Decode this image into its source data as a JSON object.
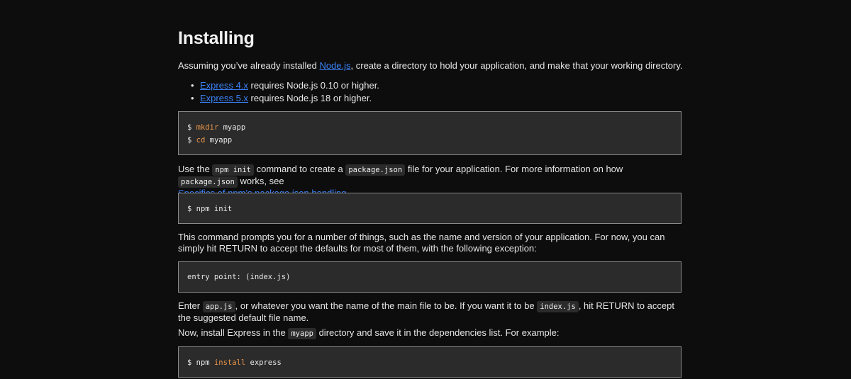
{
  "heading": "Installing",
  "intro": {
    "before": "Assuming you’ve already installed ",
    "link": "Node.js",
    "after": ", create a directory to hold your application, and make that your working directory."
  },
  "versions": [
    {
      "link": "Express 4.x",
      "text": " requires Node.js 0.10 or higher."
    },
    {
      "link": "Express 5.x",
      "text": " requires Node.js 18 or higher."
    }
  ],
  "code1": {
    "line1": {
      "prompt": "$ ",
      "cmd": "mkdir",
      "arg": " myapp"
    },
    "line2": {
      "prompt": "$ ",
      "cmd": "cd",
      "arg": " myapp"
    }
  },
  "p_init": {
    "t1": "Use the ",
    "c1": "npm init",
    "t2": " command to create a ",
    "c2": "package.json",
    "t3": " file for your application. For more information on how ",
    "c3": "package.json",
    "t4": " works, see",
    "link": "Specifics of npm’s package.json handling",
    "t5": "."
  },
  "code2": {
    "text": "$ npm init"
  },
  "p_prompts": "This command prompts you for a number of things, such as the name and version of your application. For now, you can simply hit RETURN to accept the defaults for most of them, with the following exception:",
  "code3": {
    "text": "entry point: (index.js)"
  },
  "p_enter": {
    "t1": "Enter ",
    "c1": "app.js",
    "t2": ", or whatever you want the name of the main file to be. If you want it to be ",
    "c2": "index.js",
    "t3": ", hit RETURN to accept the suggested default file name."
  },
  "p_install": {
    "t1": "Now, install Express in the ",
    "c1": "myapp",
    "t2": " directory and save it in the dependencies list. For example:"
  },
  "code4": {
    "prompt": "$ npm ",
    "cmd": "install",
    "arg": " express"
  },
  "colors": {
    "background": "#0d0d0d",
    "link": "#3b82f6",
    "code_bg": "#2b2b2b",
    "code_keyword": "#e8964a"
  }
}
